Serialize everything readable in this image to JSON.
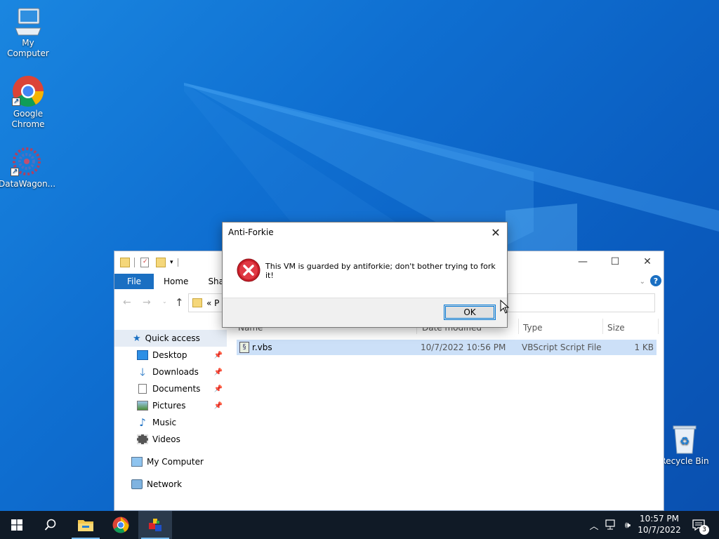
{
  "desktop": {
    "icons": [
      {
        "label": "My Computer",
        "icon": "computer-icon"
      },
      {
        "label": "Google Chrome",
        "icon": "chrome-icon"
      },
      {
        "label": "DataWagon...",
        "icon": "datawagon-icon"
      },
      {
        "label": "Recycle Bin",
        "icon": "recycle-bin-icon"
      }
    ]
  },
  "explorer": {
    "tabs": {
      "file": "File",
      "home": "Home",
      "share": "Share"
    },
    "address": "« P",
    "nav": {
      "quick_access": "Quick access",
      "desktop": "Desktop",
      "downloads": "Downloads",
      "documents": "Documents",
      "pictures": "Pictures",
      "music": "Music",
      "videos": "Videos",
      "my_computer": "My Computer",
      "network": "Network"
    },
    "columns": {
      "name": "Name",
      "date": "Date modified",
      "type": "Type",
      "size": "Size"
    },
    "files": [
      {
        "name": "r.vbs",
        "date": "10/7/2022 10:56 PM",
        "type": "VBScript Script File",
        "size": "1 KB"
      }
    ]
  },
  "dialog": {
    "title": "Anti-Forkie",
    "message": "This VM is guarded by antiforkie; don't bother trying to fork it!",
    "ok": "OK"
  },
  "taskbar": {
    "time": "10:57 PM",
    "date": "10/7/2022",
    "notification_count": "3"
  },
  "colors": {
    "desktop": "#0f6fd1",
    "taskbar": "#101a26",
    "accent": "#0078d7",
    "error": "#d0202a"
  }
}
